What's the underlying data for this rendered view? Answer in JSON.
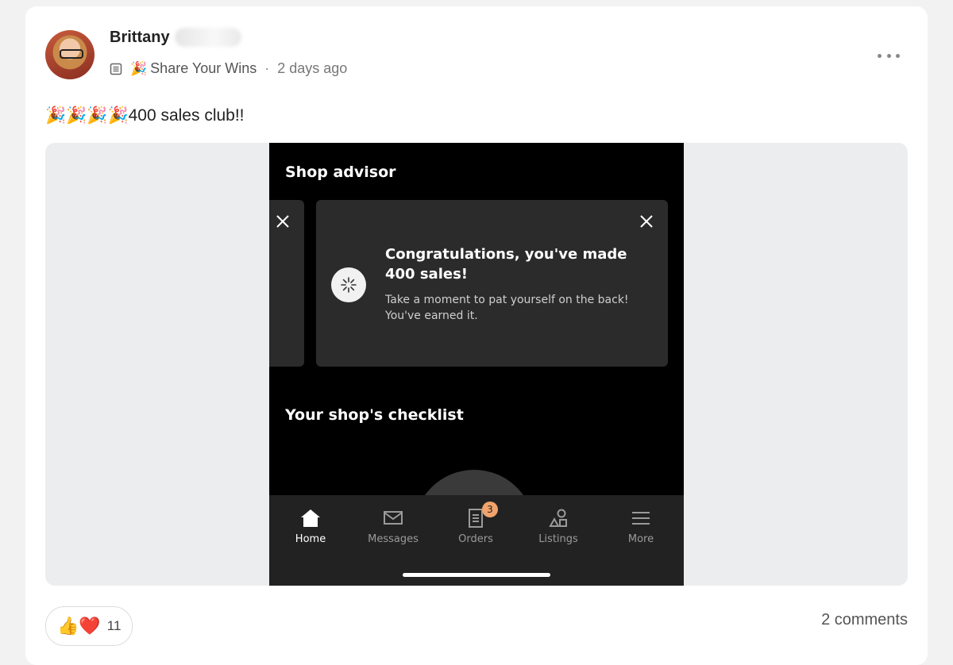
{
  "post": {
    "author": "Brittany",
    "group_icon": "document-list-icon",
    "group_emoji": "🎉",
    "group_name": "Share Your Wins",
    "separator": "·",
    "time_ago": "2 days ago",
    "more_icon": "more-dots-icon",
    "text": "🎉🎉🎉🎉400 sales club!!"
  },
  "screenshot": {
    "shop_advisor_title": "Shop advisor",
    "advisor_heading": "Congratulations, you've made 400 sales!",
    "advisor_body": "Take a moment to pat yourself on the back! You've earned it.",
    "checklist_title": "Your shop's checklist",
    "tabs": [
      {
        "label": "Home",
        "icon": "home-icon",
        "active": true
      },
      {
        "label": "Messages",
        "icon": "envelope-icon",
        "active": false
      },
      {
        "label": "Orders",
        "icon": "receipt-icon",
        "active": false,
        "badge": "3"
      },
      {
        "label": "Listings",
        "icon": "shapes-icon",
        "active": false
      },
      {
        "label": "More",
        "icon": "menu-icon",
        "active": false
      }
    ]
  },
  "footer": {
    "reaction_emojis": "👍❤️",
    "reaction_count": "11",
    "comments": "2 comments"
  },
  "colors": {
    "card": "#ffffff",
    "page": "#f2f2f2",
    "media_bg": "#ecedef",
    "phone_bg": "#000000",
    "phone_card": "#2b2b2b",
    "tabbar": "#222222",
    "badge": "#f1a36b"
  }
}
